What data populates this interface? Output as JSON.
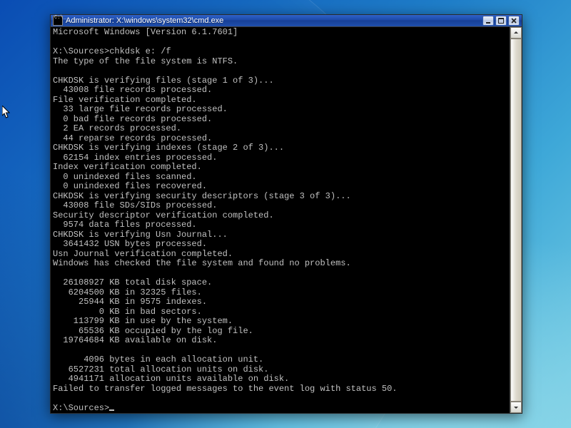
{
  "window": {
    "title": "Administrator: X:\\windows\\system32\\cmd.exe"
  },
  "console": {
    "header": "Microsoft Windows [Version 6.1.7601]",
    "prompt1": "X:\\Sources>",
    "command1": "chkdsk e: /f",
    "lines_pre": [
      "The type of the file system is NTFS.",
      "",
      "CHKDSK is verifying files (stage 1 of 3)..."
    ],
    "stage1_count": "  43008 file records processed.",
    "lines_mid1": [
      "File verification completed.",
      "  33 large file records processed.",
      "  0 bad file records processed.",
      "  2 EA records processed.",
      "  44 reparse records processed.",
      "CHKDSK is verifying indexes (stage 2 of 3)..."
    ],
    "stage2_count": "  62154 index entries processed.",
    "lines_mid2": [
      "Index verification completed.",
      "  0 unindexed files scanned.",
      "  0 unindexed files recovered.",
      "CHKDSK is verifying security descriptors (stage 3 of 3)..."
    ],
    "stage3_count": "  43008 file SDs/SIDs processed.",
    "lines_mid3": [
      "Security descriptor verification completed.",
      "  9574 data files processed.",
      "CHKDSK is verifying Usn Journal..."
    ],
    "usn_count": "  3641432 USN bytes processed.",
    "lines_post": [
      "Usn Journal verification completed.",
      "Windows has checked the file system and found no problems.",
      "",
      "  26108927 KB total disk space.",
      "   6204500 KB in 32325 files.",
      "     25944 KB in 9575 indexes.",
      "         0 KB in bad sectors.",
      "    113799 KB in use by the system.",
      "     65536 KB occupied by the log file.",
      "  19764684 KB available on disk.",
      "",
      "      4096 bytes in each allocation unit.",
      "   6527231 total allocation units on disk.",
      "   4941171 allocation units available on disk.",
      "Failed to transfer logged messages to the event log with status 50."
    ],
    "prompt2": "X:\\Sources>"
  }
}
